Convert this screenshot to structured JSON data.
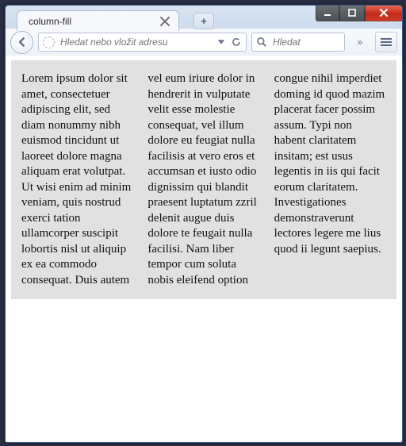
{
  "tab": {
    "title": "column-fill"
  },
  "buttons": {
    "newtab_label": "+",
    "overflow_label": "»"
  },
  "urlbar": {
    "placeholder": "Hledat nebo vložit adresu"
  },
  "search": {
    "placeholder": "Hledat"
  },
  "article": {
    "text": "Lorem ipsum dolor sit amet, consectetuer adipiscing elit, sed diam nonummy nibh euismod tincidunt ut laoreet dolore magna aliquam erat volutpat. Ut wisi enim ad minim veniam, quis nostrud exerci tation ullamcorper suscipit lobortis nisl ut aliquip ex ea commodo consequat. Duis autem vel eum iriure dolor in hendrerit in vulputate velit esse molestie consequat, vel illum dolore eu feugiat nulla facilisis at vero eros et accumsan et iusto odio dignissim qui blandit praesent luptatum zzril delenit augue duis dolore te feugait nulla facilisi. Nam liber tempor cum soluta nobis eleifend option congue nihil imperdiet doming id quod mazim placerat facer possim assum. Typi non habent claritatem insitam; est usus legentis in iis qui facit eorum claritatem. Investigationes demonstraverunt lectores legere me lius quod ii legunt saepius."
  }
}
